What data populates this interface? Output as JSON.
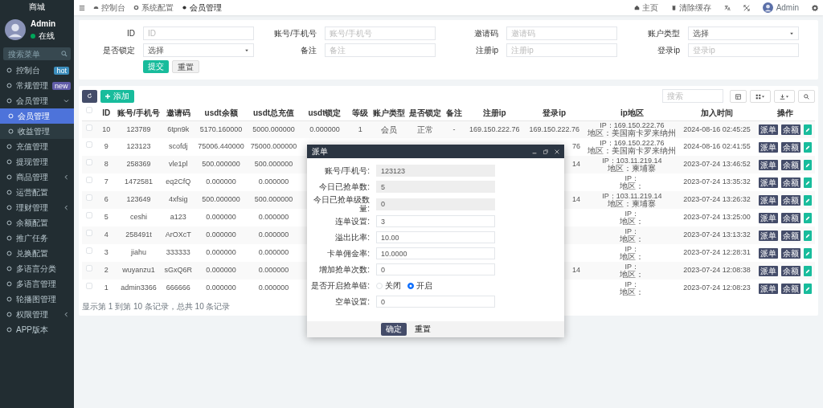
{
  "sidebar": {
    "brand": "商城",
    "user": {
      "name": "Admin",
      "status": "在线"
    },
    "search": {
      "placeholder": "搜索菜单"
    },
    "items": [
      {
        "label": "控制台",
        "kind": "link",
        "selected": false,
        "badge": {
          "text": "hot",
          "color": "#3c8dbc"
        }
      },
      {
        "label": "常规管理",
        "kind": "link",
        "selected": false,
        "badge": {
          "text": "new",
          "color": "#605ca8"
        }
      },
      {
        "label": "会员管理",
        "kind": "group",
        "expanded": true,
        "selected": false,
        "children": [
          {
            "label": "会员管理",
            "selected": true
          },
          {
            "label": "收益管理",
            "selected": false
          }
        ]
      },
      {
        "label": "充值管理",
        "kind": "link",
        "selected": false
      },
      {
        "label": "提现管理",
        "kind": "link",
        "selected": false
      },
      {
        "label": "商品管理",
        "kind": "group",
        "expanded": false,
        "selected": false
      },
      {
        "label": "运营配置",
        "kind": "link",
        "selected": false
      },
      {
        "label": "理财管理",
        "kind": "group",
        "expanded": false,
        "selected": false
      },
      {
        "label": "余额配置",
        "kind": "link",
        "selected": false
      },
      {
        "label": "推广任务",
        "kind": "link",
        "selected": false
      },
      {
        "label": "兑换配置",
        "kind": "link",
        "selected": false
      },
      {
        "label": "多语言分类",
        "kind": "link",
        "selected": false
      },
      {
        "label": "多语言管理",
        "kind": "link",
        "selected": false
      },
      {
        "label": "轮播图管理",
        "kind": "link",
        "selected": false
      },
      {
        "label": "权限管理",
        "kind": "group",
        "expanded": false,
        "selected": false
      },
      {
        "label": "APP版本",
        "kind": "link",
        "selected": false
      }
    ]
  },
  "topbar": {
    "tabs": [
      {
        "label": "控制台",
        "selected": false
      },
      {
        "label": "系统配置",
        "selected": false
      },
      {
        "label": "会员管理",
        "selected": true
      }
    ],
    "links": [
      "主页",
      "清除缓存"
    ],
    "user": "Admin"
  },
  "filter": {
    "fields": [
      {
        "label": "ID",
        "kind": "input",
        "placeholder": "ID"
      },
      {
        "label": "账号/手机号",
        "kind": "input",
        "placeholder": "账号/手机号"
      },
      {
        "label": "邀请码",
        "kind": "input",
        "placeholder": "邀请码"
      },
      {
        "label": "账户类型",
        "kind": "select",
        "value": "选择"
      },
      {
        "label": "是否锁定",
        "kind": "select",
        "value": "选择"
      },
      {
        "label": "备注",
        "kind": "input",
        "placeholder": "备注"
      },
      {
        "label": "注册ip",
        "kind": "input",
        "placeholder": "注册ip"
      },
      {
        "label": "登录ip",
        "kind": "input",
        "placeholder": "登录ip"
      }
    ],
    "buttons": [
      "提交",
      "重置"
    ]
  },
  "toolbar": {
    "add_button": "添加",
    "search": {
      "placeholder": "搜索"
    }
  },
  "table": {
    "header_checked": false,
    "columns": [
      "ID",
      "账号/手机号",
      "邀请码",
      "usdt余额",
      "usdt总充值",
      "usdt锁定",
      "等级",
      "账户类型",
      "是否锁定",
      "备注",
      "注册ip",
      "登录ip",
      "ip地区",
      "加入时间",
      "操作"
    ],
    "rows": [
      {
        "checked": false,
        "id": "10",
        "account": "123789",
        "invite": "6tpn9k",
        "balance": "5170.160000",
        "total": "5000.000000",
        "lock": "0.000000",
        "level": "1",
        "type": "会员",
        "locked": "正常",
        "remark": "-",
        "reg_ip": "169.150.222.76",
        "login_ip": "169.150.222.76",
        "ip": "IP：169.150.222.76",
        "region": "地区：美国南卡罗来纳州",
        "time": "2024-08-16 02:45:25",
        "actions": [
          "派单",
          "余额"
        ]
      },
      {
        "checked": false,
        "id": "9",
        "account": "123123",
        "invite": "scofdj",
        "balance": "75006.440000",
        "total": "75000.000000",
        "login_ip": "76",
        "ip": "IP：169.150.222.76",
        "region": "地区：美国南卡罗来纳州",
        "time": "2024-08-16 02:41:55",
        "actions": [
          "派单",
          "余额"
        ]
      },
      {
        "checked": false,
        "id": "8",
        "account": "258369",
        "invite": "vle1pl",
        "balance": "500.000000",
        "total": "500.000000",
        "login_ip": "14",
        "ip": "IP：103.11.219.14",
        "region": "地区：柬埔寨",
        "time": "2023-07-24 13:46:52",
        "actions": [
          "派单",
          "余额"
        ]
      },
      {
        "checked": false,
        "id": "7",
        "account": "1472581",
        "invite": "eq2CfQ",
        "balance": "0.000000",
        "total": "0.000000",
        "ip": "IP：",
        "region": "地区：",
        "time": "2023-07-24 13:35:32",
        "actions": [
          "派单",
          "余额"
        ]
      },
      {
        "checked": false,
        "id": "6",
        "account": "123649",
        "invite": "4xfsig",
        "balance": "500.000000",
        "total": "500.000000",
        "login_ip": "14",
        "ip": "IP：103.11.219.14",
        "region": "地区：柬埔寨",
        "time": "2023-07-24 13:26:32",
        "actions": [
          "派单",
          "余额"
        ]
      },
      {
        "checked": false,
        "id": "5",
        "account": "ceshi",
        "invite": "a123",
        "balance": "0.000000",
        "total": "0.000000",
        "ip": "IP：",
        "region": "地区：",
        "time": "2023-07-24 13:25:00",
        "actions": [
          "派单",
          "余额"
        ]
      },
      {
        "checked": false,
        "id": "4",
        "account": "258491t",
        "invite": "ArOXcT",
        "balance": "0.000000",
        "total": "0.000000",
        "ip": "IP：",
        "region": "地区：",
        "time": "2023-07-24 13:13:32",
        "actions": [
          "派单",
          "余额"
        ]
      },
      {
        "checked": false,
        "id": "3",
        "account": "jiahu",
        "invite": "333333",
        "balance": "0.000000",
        "total": "0.000000",
        "ip": "IP：",
        "region": "地区：",
        "time": "2023-07-24 12:28:31",
        "actions": [
          "派单",
          "余额"
        ]
      },
      {
        "checked": false,
        "id": "2",
        "account": "wuyanzu1",
        "invite": "sGxQ6R",
        "balance": "0.000000",
        "total": "0.000000",
        "login_ip": "14",
        "ip": "IP：",
        "region": "地区：",
        "time": "2023-07-24 12:08:38",
        "actions": [
          "派单",
          "余额"
        ]
      },
      {
        "checked": false,
        "id": "1",
        "account": "admin3366",
        "invite": "666666",
        "balance": "0.000000",
        "total": "0.000000",
        "ip": "IP：",
        "region": "地区：",
        "time": "2023-07-24 12:08:23",
        "actions": [
          "派单",
          "余额"
        ]
      }
    ],
    "footer": "显示第 1 到第 10 条记录，总共 10 条记录"
  },
  "modal": {
    "title": "派单",
    "fields": [
      {
        "label": "账号/手机号:",
        "kind": "readonly",
        "value": "123123"
      },
      {
        "label": "今日已抢单数:",
        "kind": "readonly",
        "value": "5"
      },
      {
        "label": "今日已抢单级数量:",
        "kind": "readonly",
        "value": "0"
      },
      {
        "label": "连单设置:",
        "kind": "input",
        "value": "3"
      },
      {
        "label": "溢出比率:",
        "kind": "input",
        "value": "10.00"
      },
      {
        "label": "卡单佣金率:",
        "kind": "input",
        "value": "10.0000"
      },
      {
        "label": "增加抢单次数:",
        "kind": "input",
        "value": "0"
      },
      {
        "label": "是否开启抢单链:",
        "kind": "radio",
        "options": [
          {
            "label": "关闭",
            "selected": false
          },
          {
            "label": "开启",
            "selected": true
          }
        ]
      },
      {
        "label": "空单设置:",
        "kind": "input",
        "value": "0"
      }
    ],
    "buttons": [
      "确定",
      "重置"
    ]
  }
}
